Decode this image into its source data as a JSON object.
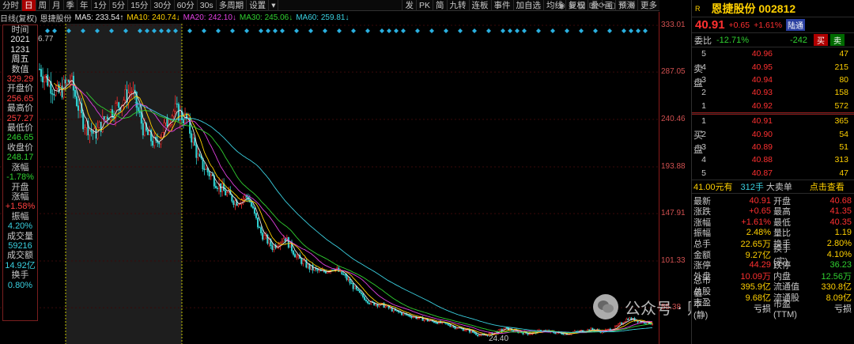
{
  "toolbar": {
    "left_buttons": [
      "分时",
      "日",
      "周",
      "月",
      "季",
      "年",
      "1分",
      "5分",
      "15分",
      "30分",
      "60分",
      "30s",
      "多周期",
      "设置"
    ],
    "active_index": 1,
    "dropdown_arrow": "▾",
    "right_buttons": [
      "发",
      "PK",
      "简",
      "九转",
      "连板",
      "事件",
      "加自选",
      "均线",
      "复权",
      "叠",
      "画",
      "预测",
      "更多"
    ]
  },
  "ma_legend": {
    "prefix": "日线(复权)",
    "stock": "恩捷股份",
    "items": [
      {
        "text": "MA5: 233.54↑",
        "color": "#e8e8e8"
      },
      {
        "text": "MA10: 240.74↓",
        "color": "#ffd000"
      },
      {
        "text": "MA20: 242.10↓",
        "color": "#e040e0"
      },
      {
        "text": "MA30: 245.06↓",
        "color": "#30d030"
      },
      {
        "text": "MA60: 259.81↓",
        "color": "#3ad0e0"
      }
    ]
  },
  "price_axis": [
    "333.01",
    "287.05",
    "240.46",
    "193.88",
    "147.91",
    "101.33",
    "55.38"
  ],
  "chart_labels": {
    "peak": "6.77",
    "low": "24.40"
  },
  "info_panel": [
    {
      "text": "时间",
      "cls": "k"
    },
    {
      "text": "2021",
      "cls": "v-white"
    },
    {
      "text": "1231",
      "cls": "v-white"
    },
    {
      "text": "周五",
      "cls": "v-white"
    },
    {
      "text": "数值",
      "cls": "k"
    },
    {
      "text": "329.29",
      "cls": "v-red"
    },
    {
      "text": "开盘价",
      "cls": "k"
    },
    {
      "text": "256.65",
      "cls": "v-red"
    },
    {
      "text": "最高价",
      "cls": "k"
    },
    {
      "text": "257.27",
      "cls": "v-red"
    },
    {
      "text": "最低价",
      "cls": "k"
    },
    {
      "text": "246.65",
      "cls": "v-green"
    },
    {
      "text": "收盘价",
      "cls": "k"
    },
    {
      "text": "248.17",
      "cls": "v-green"
    },
    {
      "text": "涨幅",
      "cls": "k"
    },
    {
      "text": "-1.78%",
      "cls": "v-green"
    },
    {
      "text": "开盘",
      "cls": "k"
    },
    {
      "text": "涨幅",
      "cls": "k"
    },
    {
      "text": "+1.58%",
      "cls": "v-red"
    },
    {
      "text": "振幅",
      "cls": "k"
    },
    {
      "text": "4.20%",
      "cls": "v-cyan"
    },
    {
      "text": "成交量",
      "cls": "k"
    },
    {
      "text": "59216",
      "cls": "v-cyan"
    },
    {
      "text": "成交额",
      "cls": "k"
    },
    {
      "text": "14.92亿",
      "cls": "v-cyan"
    },
    {
      "text": "换手",
      "cls": "k"
    },
    {
      "text": "0.80%",
      "cls": "v-cyan"
    }
  ],
  "quote": {
    "badge": "R",
    "title": "恩捷股份 002812",
    "price": "40.91",
    "change": "+0.65",
    "change_pct": "+1.61%",
    "tag": "陆通",
    "weibi_label": "委比",
    "weibi": "-12.71%",
    "weicha": "-242",
    "buy_btn": "买",
    "sell_btn": "卖"
  },
  "order_book": {
    "sell_label": "卖盘",
    "buy_label": "买盘",
    "asks": [
      {
        "level": "5",
        "price": "40.96",
        "vol": "47"
      },
      {
        "level": "4",
        "price": "40.95",
        "vol": "215"
      },
      {
        "level": "3",
        "price": "40.94",
        "vol": "80"
      },
      {
        "level": "2",
        "price": "40.93",
        "vol": "158"
      },
      {
        "level": "1",
        "price": "40.92",
        "vol": "572"
      }
    ],
    "bids": [
      {
        "level": "1",
        "price": "40.91",
        "vol": "365"
      },
      {
        "level": "2",
        "price": "40.90",
        "vol": "54"
      },
      {
        "level": "3",
        "price": "40.89",
        "vol": "51"
      },
      {
        "level": "4",
        "price": "40.88",
        "vol": "313"
      },
      {
        "level": "5",
        "price": "40.87",
        "vol": "47"
      }
    ]
  },
  "big_order": {
    "price": "41.00元有",
    "count": "312手",
    "label": "大卖单",
    "action": "点击查看"
  },
  "stats": [
    {
      "k1": "最新",
      "v1": "40.91",
      "c1": "c-red",
      "k2": "开盘",
      "v2": "40.68",
      "c2": "c-red"
    },
    {
      "k1": "涨跌",
      "v1": "+0.65",
      "c1": "c-red",
      "k2": "最高",
      "v2": "41.35",
      "c2": "c-red"
    },
    {
      "k1": "涨幅",
      "v1": "+1.61%",
      "c1": "c-red",
      "k2": "最低",
      "v2": "40.35",
      "c2": "c-red"
    },
    {
      "k1": "振幅",
      "v1": "2.48%",
      "c1": "c-yellow",
      "k2": "量比",
      "v2": "1.19",
      "c2": "c-yellow"
    },
    {
      "k1": "总手",
      "v1": "22.65万",
      "c1": "c-yellow",
      "k2": "换手",
      "v2": "2.80%",
      "c2": "c-yellow"
    },
    {
      "k1": "金额",
      "v1": "9.27亿",
      "c1": "c-yellow",
      "k2": "换手(实)",
      "v2": "4.10%",
      "c2": "c-yellow"
    },
    {
      "k1": "涨停",
      "v1": "44.29",
      "c1": "c-red",
      "k2": "跌停",
      "v2": "36.23",
      "c2": "c-green"
    },
    {
      "k1": "外盘",
      "v1": "10.09万",
      "c1": "c-red",
      "k2": "内盘",
      "v2": "12.56万",
      "c2": "c-green"
    },
    {
      "k1": "总市值",
      "v1": "395.9亿",
      "c1": "c-yellow",
      "k2": "流通值",
      "v2": "330.8亿",
      "c2": "c-yellow"
    },
    {
      "k1": "总股本",
      "v1": "9.68亿",
      "c1": "c-yellow",
      "k2": "流通股",
      "v2": "8.09亿",
      "c2": "c-yellow"
    },
    {
      "k1": "市盈(静)",
      "v1": "亏损",
      "c1": "c-white",
      "k2": "市盈(TTM)",
      "v2": "亏损",
      "c2": "c-white"
    }
  ],
  "watermark": {
    "text": "公众号 · 财富独角兽"
  },
  "chart_data": {
    "type": "candlestick",
    "ylim": [
      24.4,
      333.01
    ],
    "y_ticks": [
      333.01,
      287.05,
      240.46,
      193.88,
      147.91,
      101.33,
      55.38
    ],
    "trend": [
      [
        0,
        290
      ],
      [
        0.03,
        265
      ],
      [
        0.05,
        280
      ],
      [
        0.07,
        240
      ],
      [
        0.09,
        225
      ],
      [
        0.11,
        245
      ],
      [
        0.13,
        255
      ],
      [
        0.15,
        270
      ],
      [
        0.17,
        230
      ],
      [
        0.19,
        215
      ],
      [
        0.2,
        230
      ],
      [
        0.22,
        250
      ],
      [
        0.24,
        240
      ],
      [
        0.26,
        200
      ],
      [
        0.28,
        185
      ],
      [
        0.3,
        170
      ],
      [
        0.32,
        160
      ],
      [
        0.34,
        165
      ],
      [
        0.36,
        130
      ],
      [
        0.38,
        115
      ],
      [
        0.4,
        125
      ],
      [
        0.42,
        105
      ],
      [
        0.44,
        95
      ],
      [
        0.46,
        90
      ],
      [
        0.48,
        95
      ],
      [
        0.5,
        85
      ],
      [
        0.52,
        70
      ],
      [
        0.54,
        60
      ],
      [
        0.56,
        58
      ],
      [
        0.58,
        52
      ],
      [
        0.6,
        48
      ],
      [
        0.62,
        45
      ],
      [
        0.64,
        42
      ],
      [
        0.66,
        40
      ],
      [
        0.68,
        36
      ],
      [
        0.7,
        33
      ],
      [
        0.72,
        28
      ],
      [
        0.74,
        30
      ],
      [
        0.76,
        35
      ],
      [
        0.78,
        32
      ],
      [
        0.8,
        30
      ],
      [
        0.82,
        33
      ],
      [
        0.84,
        31
      ],
      [
        0.86,
        30
      ],
      [
        0.88,
        32
      ],
      [
        0.9,
        34
      ],
      [
        0.92,
        32
      ],
      [
        0.94,
        36
      ],
      [
        0.96,
        45
      ],
      [
        0.98,
        42
      ],
      [
        1.0,
        40
      ]
    ],
    "ma_colors": [
      "#e8e8e8",
      "#ffd000",
      "#e040e0",
      "#30d030",
      "#3ad0e0"
    ]
  }
}
